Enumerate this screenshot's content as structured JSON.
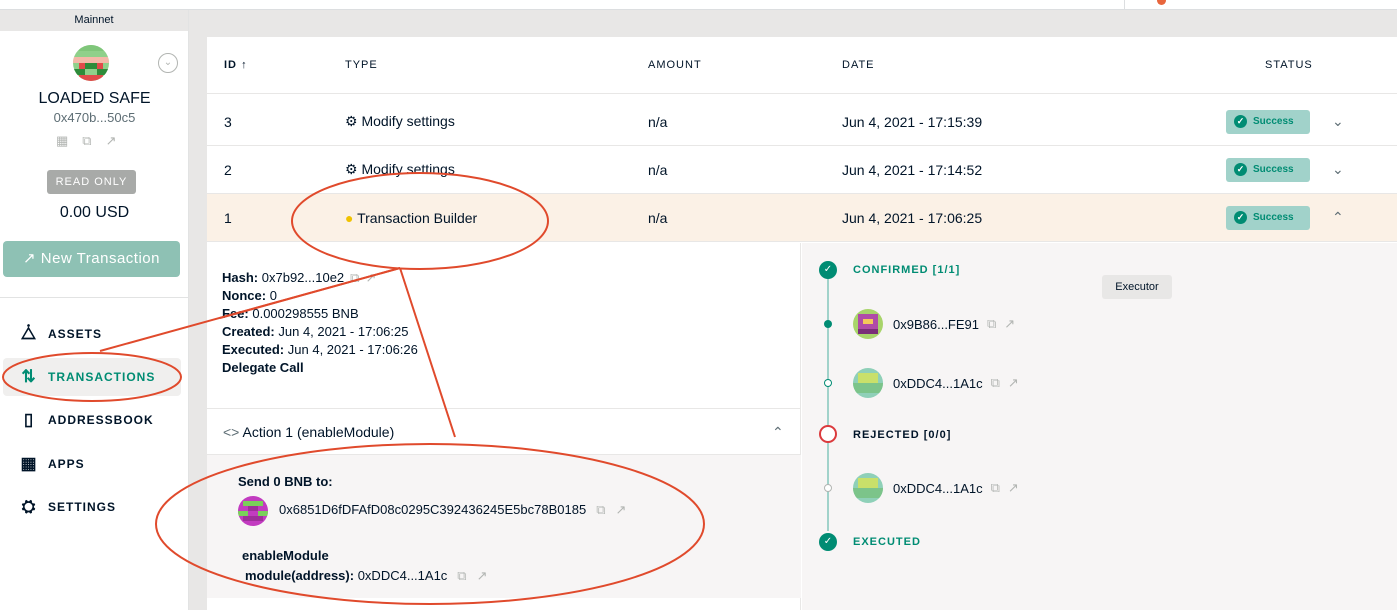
{
  "network": "Mainnet",
  "safe": {
    "name": "LOADED SAFE",
    "address": "0x470b...50c5",
    "mode": "READ ONLY",
    "balance": "0.00 USD",
    "new_tx_label": "New Transaction"
  },
  "nav": [
    {
      "label": "ASSETS",
      "icon": "assets-icon"
    },
    {
      "label": "TRANSACTIONS",
      "icon": "transactions-icon"
    },
    {
      "label": "ADDRESSBOOK",
      "icon": "addressbook-icon"
    },
    {
      "label": "APPS",
      "icon": "apps-icon"
    },
    {
      "label": "SETTINGS",
      "icon": "settings-icon"
    }
  ],
  "table": {
    "headers": {
      "id": "ID",
      "type": "TYPE",
      "amount": "AMOUNT",
      "date": "DATE",
      "status": "STATUS"
    },
    "rows": [
      {
        "id": "3",
        "type": "Modify settings",
        "amount": "n/a",
        "date": "Jun 4, 2021 - 17:15:39",
        "status": "Success"
      },
      {
        "id": "2",
        "type": "Modify settings",
        "amount": "n/a",
        "date": "Jun 4, 2021 - 17:14:52",
        "status": "Success"
      },
      {
        "id": "1",
        "type": "Transaction Builder",
        "amount": "n/a",
        "date": "Jun 4, 2021 - 17:06:25",
        "status": "Success"
      }
    ]
  },
  "details": {
    "hash_label": "Hash:",
    "hash": "0x7b92...10e2",
    "nonce_label": "Nonce:",
    "nonce": "0",
    "fee_label": "Fee:",
    "fee": "0.000298555 BNB",
    "created_label": "Created:",
    "created": "Jun 4, 2021 - 17:06:25",
    "executed_label": "Executed:",
    "executed": "Jun 4, 2021 - 17:06:26",
    "call_type": "Delegate Call"
  },
  "action": {
    "title": "Action 1 (enableModule)",
    "send_title": "Send 0 BNB to:",
    "to_address": "0x6851D6fDFAfD08c0295C392436245E5bc78B0185",
    "method": "enableModule",
    "param_label": "module(address):",
    "param_value": "0xDDC4...1A1c"
  },
  "timeline": {
    "confirmed": "CONFIRMED [1/1]",
    "owner1": "0x9B86...FE91",
    "owner2": "0xDDC4...1A1c",
    "rejected": "REJECTED [0/0]",
    "owner3": "0xDDC4...1A1c",
    "executed": "EXECUTED",
    "executor_label": "Executor"
  },
  "colors": {
    "accent": "#008c73",
    "success_bg": "#a1d2ca",
    "button": "#8ec1b4",
    "annotation": "#e04a2c",
    "reject": "#db3a3d"
  }
}
